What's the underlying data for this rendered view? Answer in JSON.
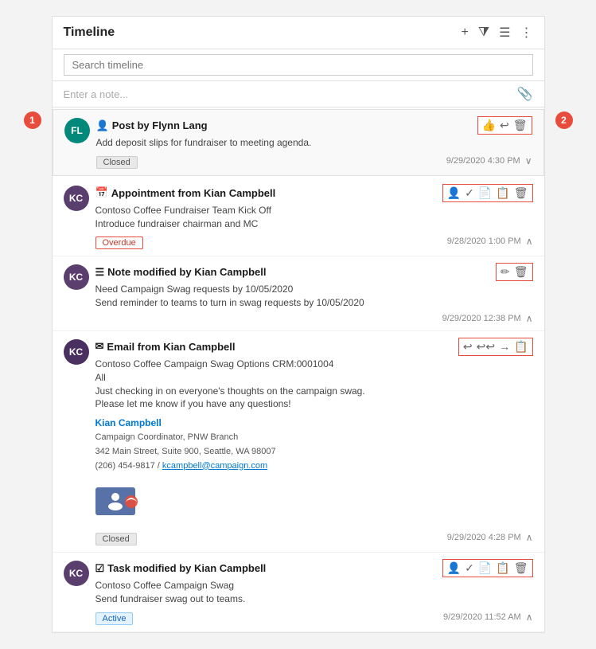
{
  "header": {
    "title": "Timeline",
    "add_label": "+",
    "filter_label": "⛉",
    "sort_label": "≡",
    "more_label": "⋮"
  },
  "search": {
    "placeholder": "Search timeline"
  },
  "note": {
    "placeholder": "Enter a note...",
    "attach_icon": "📎"
  },
  "items": [
    {
      "id": "post-1",
      "type": "post",
      "type_icon": "👤",
      "avatar_initials": "FL",
      "avatar_class": "avatar-fl",
      "title": "Post by Flynn Lang",
      "body": "Add deposit slips for fundraiser to meeting agenda.",
      "badge": "Closed",
      "badge_type": "closed",
      "timestamp": "9/29/2020 4:30 PM",
      "chevron": "∨",
      "actions": [
        "👍",
        "↩",
        "🗑"
      ]
    },
    {
      "id": "appt-1",
      "type": "appointment",
      "type_icon": "📅",
      "avatar_initials": "KC",
      "avatar_class": "avatar-kc-dark",
      "title": "Appointment from Kian Campbell",
      "body": "Contoso Coffee Fundraiser Team Kick Off\nIntroduce fundraiser chairman and MC",
      "badge": "Overdue",
      "badge_type": "overdue",
      "timestamp": "9/28/2020 1:00 PM",
      "chevron": "∧",
      "actions": [
        "👤",
        "✓",
        "📄",
        "📋",
        "🗑"
      ]
    },
    {
      "id": "note-1",
      "type": "note",
      "type_icon": "≡",
      "avatar_initials": "KC",
      "avatar_class": "avatar-kc-dark",
      "title": "Note modified by Kian Campbell",
      "body": "Need Campaign Swag requests by 10/05/2020\nSend reminder to teams to turn in swag requests by 10/05/2020",
      "badge": null,
      "timestamp": "9/29/2020 12:38 PM",
      "chevron": "∧",
      "actions": [
        "✏",
        "🗑"
      ]
    },
    {
      "id": "email-1",
      "type": "email",
      "type_icon": "✉",
      "avatar_initials": "KC",
      "avatar_class": "avatar-kc-mid",
      "title": "Email from Kian Campbell",
      "body": "Contoso Coffee Campaign Swag Options CRM:0001004\nAll\nJust checking in on everyone's thoughts on the campaign swag.\nPlease let me know if you have any questions!",
      "badge": "Closed",
      "badge_type": "closed",
      "timestamp": "9/29/2020 4:28 PM",
      "chevron": "∧",
      "actions": [
        "↩",
        "↩↩",
        "→",
        "📋"
      ],
      "signature": {
        "name": "Kian Campbell",
        "title": "Campaign Coordinator, PNW Branch",
        "address": "342 Main Street, Suite 900, Seattle, WA 98007",
        "phone": "(206) 454-9817",
        "email": "kcampbell@campaign.com"
      }
    },
    {
      "id": "task-1",
      "type": "task",
      "type_icon": "☑",
      "avatar_initials": "KC",
      "avatar_class": "avatar-kc-dark",
      "title": "Task modified by Kian Campbell",
      "body": "Contoso Coffee Campaign Swag\nSend fundraiser swag out to teams.",
      "badge": "Active",
      "badge_type": "active",
      "timestamp": "9/29/2020 11:52 AM",
      "chevron": "∧",
      "actions": [
        "👤",
        "✓",
        "📄",
        "📋",
        "🗑"
      ]
    }
  ],
  "callouts": {
    "left": "1",
    "right": "2"
  }
}
